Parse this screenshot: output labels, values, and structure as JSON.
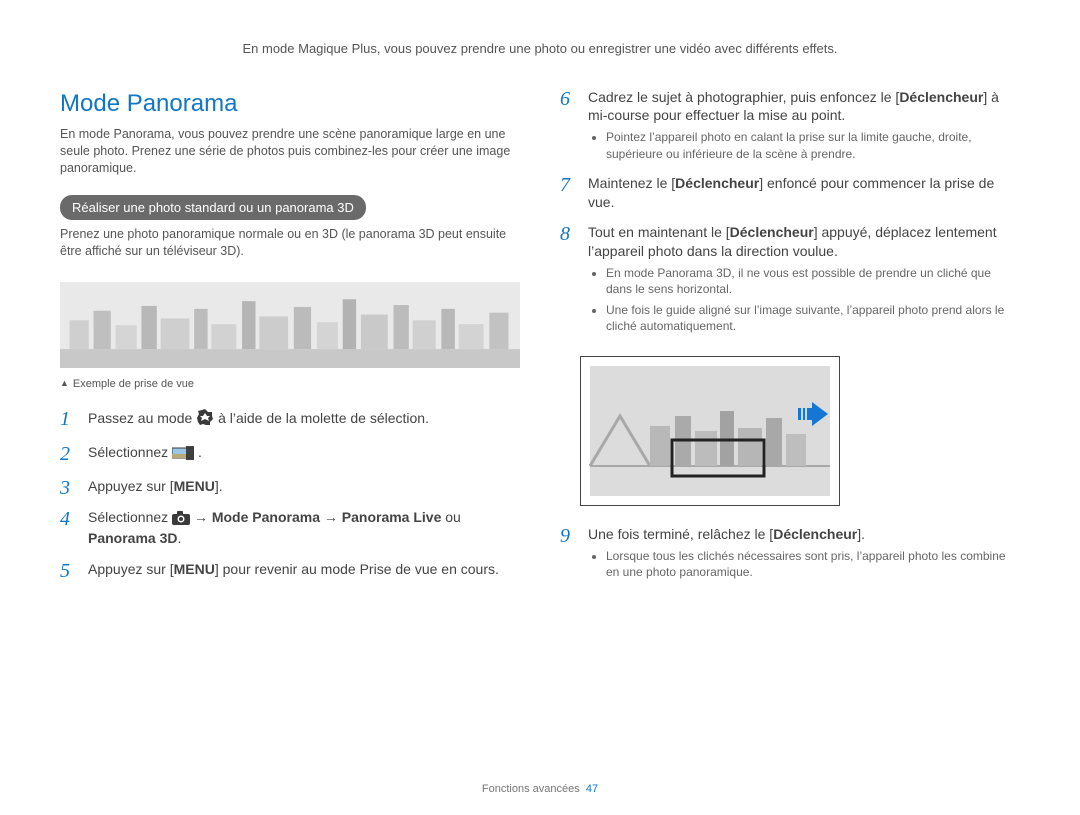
{
  "intro": "En mode Magique Plus, vous pouvez prendre une photo ou enregistrer une vidéo avec différents effets.",
  "section_title": "Mode Panorama",
  "section_desc": "En mode Panorama, vous pouvez prendre une scène panoramique large en une seule photo. Prenez une série de photos puis combinez-les pour créer une image panoramique.",
  "pill": "Réaliser une photo standard ou un panorama 3D",
  "pill_desc": "Prenez une photo panoramique normale ou en 3D (le panorama 3D peut ensuite être affiché sur un téléviseur 3D).",
  "caption": "Exemple de prise de vue",
  "steps_left": {
    "s1_pre": "Passez au mode ",
    "s1_post": " à l’aide de la molette de sélection.",
    "s2_pre": "Sélectionnez ",
    "s2_post": ".",
    "s3_pre": "Appuyez sur [",
    "s3_menu": "MENU",
    "s3_post": "].",
    "s4_pre": "Sélectionnez ",
    "s4_mid1": " → ",
    "s4_b1": "Mode Panorama",
    "s4_mid2": " → ",
    "s4_b2": "Panorama Live",
    "s4_or": " ou ",
    "s4_b3": "Panorama 3D",
    "s4_post": ".",
    "s5_pre": "Appuyez sur [",
    "s5_menu": "MENU",
    "s5_post": "] pour revenir au mode Prise de vue en cours."
  },
  "steps_right": {
    "s6_a": "Cadrez le sujet à photographier, puis enfoncez le [",
    "s6_b": "Déclencheur",
    "s6_c": "] à mi-course pour effectuer la mise au point.",
    "s6_sub1": "Pointez l’appareil photo en calant la prise sur la limite gauche, droite, supérieure ou inférieure de la scène à prendre.",
    "s7_a": "Maintenez le [",
    "s7_b": "Déclencheur",
    "s7_c": "] enfoncé pour commencer la prise de vue.",
    "s8_a": "Tout en maintenant le [",
    "s8_b": "Déclencheur",
    "s8_c": "] appuyé, déplacez lentement l’appareil photo dans la direction voulue.",
    "s8_sub1": "En mode Panorama 3D, il ne vous est possible de prendre un cliché que dans le sens horizontal.",
    "s8_sub2": "Une fois le guide aligné sur l’image suivante, l’appareil photo prend alors le cliché automatiquement.",
    "s9_a": "Une fois terminé, relâchez le [",
    "s9_b": "Déclencheur",
    "s9_c": "].",
    "s9_sub1": "Lorsque tous les clichés nécessaires sont pris, l’appareil photo les combine en une photo panoramique."
  },
  "footer_label": "Fonctions avancées",
  "footer_page": "47"
}
